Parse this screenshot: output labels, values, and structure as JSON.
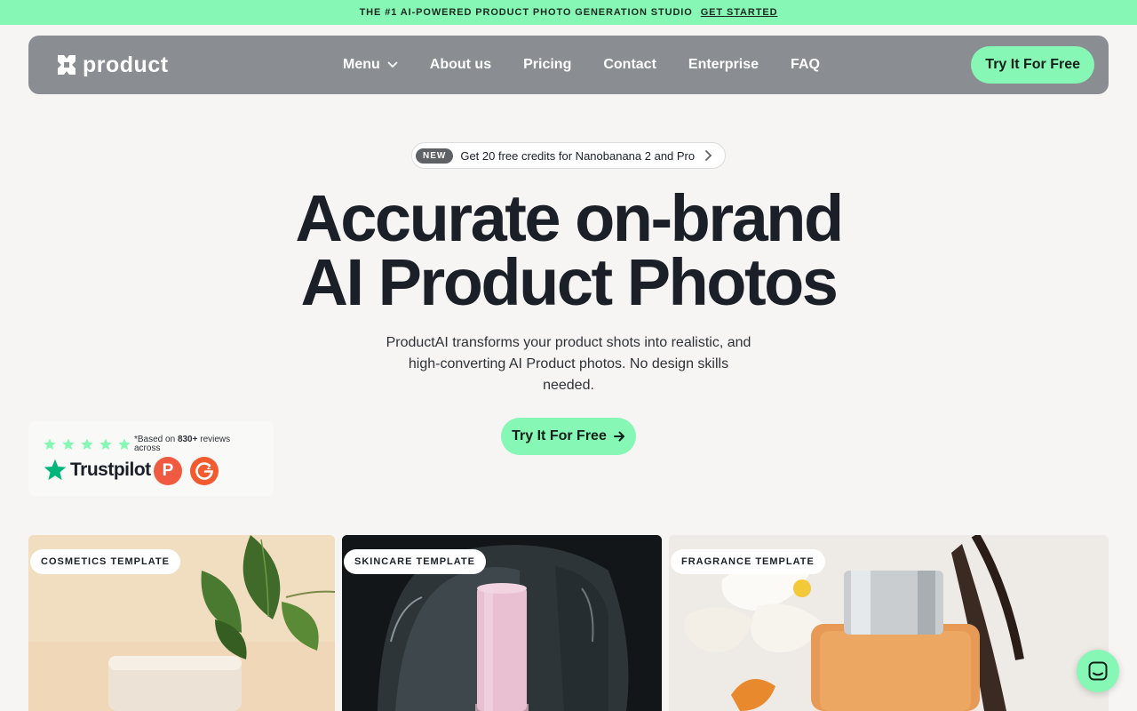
{
  "announcement": {
    "text": "THE #1 AI-POWERED PRODUCT PHOTO GENERATION STUDIO",
    "link": "GET STARTED"
  },
  "nav": {
    "logo_text": "product",
    "items": [
      {
        "label": "Menu",
        "has_dropdown": true
      },
      {
        "label": "About us"
      },
      {
        "label": "Pricing"
      },
      {
        "label": "Contact"
      },
      {
        "label": "Enterprise"
      },
      {
        "label": "FAQ"
      }
    ],
    "cta": "Try It For Free"
  },
  "promo": {
    "badge": "NEW",
    "text": "Get 20 free credits for Nanobanana 2 and Pro"
  },
  "hero": {
    "title_line1": "Accurate on-brand",
    "title_line2": "AI Product Photos",
    "subtitle": "ProductAI transforms your product shots into realistic, and high-converting AI Product photos. No design skills needed.",
    "cta": "Try It For Free"
  },
  "reviews": {
    "rating_stars": 5,
    "based_prefix": "*Based on ",
    "count": "830+",
    "based_suffix": " reviews across",
    "trustpilot": "Trustpilot",
    "p_badge": "P"
  },
  "templates": [
    {
      "label": "COSMETICS TEMPLATE"
    },
    {
      "label": "SKINCARE TEMPLATE"
    },
    {
      "label": "FRAGRANCE TEMPLATE"
    }
  ],
  "colors": {
    "accent": "#86f7b4",
    "nav_bg": "#8a8d91",
    "page_bg": "#f6f5f3",
    "text": "#1b1f27"
  }
}
